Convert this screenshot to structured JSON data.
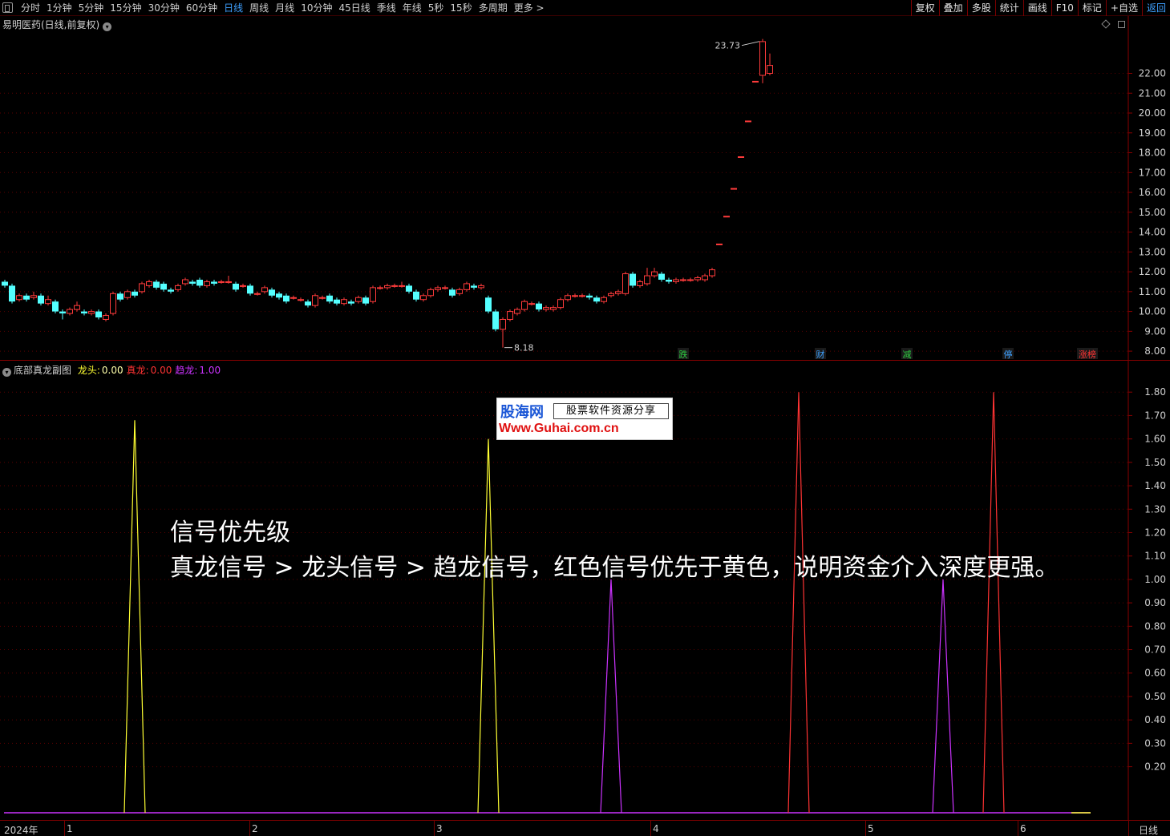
{
  "toolbar": {
    "periods": [
      "分时",
      "1分钟",
      "5分钟",
      "15分钟",
      "30分钟",
      "60分钟",
      "日线",
      "周线",
      "月线",
      "10分钟",
      "45日线",
      "季线",
      "年线",
      "5秒",
      "15秒",
      "多周期",
      "更多 >"
    ],
    "active_period": "日线",
    "tools": [
      "复权",
      "叠加",
      "多股",
      "统计",
      "画线",
      "F10",
      "标记",
      "+自选",
      "返回"
    ]
  },
  "price_panel": {
    "title": "易明医药(日线,前复权)",
    "y_ticks": [
      "22.00",
      "21.00",
      "20.00",
      "19.00",
      "18.00",
      "17.00",
      "16.00",
      "15.00",
      "14.00",
      "13.00",
      "12.00",
      "11.00",
      "10.00",
      "9.00",
      "8.00"
    ],
    "high_label": "23.73",
    "low_label": "8.18",
    "event_tags": [
      {
        "text": "跌",
        "color": "#2ecc40"
      },
      {
        "text": "财",
        "color": "#3ea0ff"
      },
      {
        "text": "减",
        "color": "#2ecc40"
      },
      {
        "text": "停",
        "color": "#3ea0ff"
      },
      {
        "text": "涨榜",
        "color": "#ff3333"
      }
    ]
  },
  "indicator_panel": {
    "name": "底部真龙副图",
    "series": [
      {
        "label": "龙头",
        "value": "0.00",
        "color": "#ffff33"
      },
      {
        "label": "真龙",
        "value": "0.00",
        "color": "#ff3333"
      },
      {
        "label": "趋龙",
        "value": "1.00",
        "color": "#cc33ff"
      }
    ],
    "y_ticks": [
      "1.80",
      "1.70",
      "1.60",
      "1.50",
      "1.40",
      "1.30",
      "1.20",
      "1.10",
      "1.00",
      "0.90",
      "0.80",
      "0.70",
      "0.60",
      "0.50",
      "0.40",
      "0.30",
      "0.20"
    ]
  },
  "watermark": {
    "logo": "股海网",
    "slogan": "股票软件资源分享",
    "url": "Www.Guhai.com.cn"
  },
  "caption": {
    "line1": "信号优先级",
    "line2": "真龙信号 > 龙头信号 > 趋龙信号，红色信号优先于黄色，说明资金介入深度更强。"
  },
  "date_bar": {
    "labels": [
      "2024年",
      "1",
      "2",
      "3",
      "4",
      "5",
      "6"
    ],
    "period": "日线"
  },
  "chart_data": [
    {
      "type": "candlestick",
      "title": "易明医药(日线,前复权)",
      "ylim": [
        7.6,
        24.0
      ],
      "x_month_labels": [
        "2024年",
        "1",
        "2",
        "3",
        "4",
        "5",
        "6"
      ],
      "candles": [
        [
          11.5,
          11.3,
          11.6,
          11.2
        ],
        [
          11.3,
          10.5,
          11.4,
          10.4
        ],
        [
          10.6,
          10.8,
          10.9,
          10.5
        ],
        [
          10.8,
          10.6,
          10.9,
          10.5
        ],
        [
          10.7,
          10.8,
          11.0,
          10.6
        ],
        [
          10.8,
          10.4,
          10.9,
          10.3
        ],
        [
          10.4,
          10.6,
          10.8,
          10.3
        ],
        [
          10.5,
          10.0,
          10.6,
          9.9
        ],
        [
          10.0,
          9.9,
          10.1,
          9.6
        ],
        [
          9.9,
          10.1,
          10.2,
          9.8
        ],
        [
          10.1,
          10.3,
          10.5,
          10.0
        ],
        [
          10.0,
          9.9,
          10.1,
          9.8
        ],
        [
          9.9,
          10.0,
          10.1,
          9.8
        ],
        [
          10.0,
          9.7,
          10.1,
          9.6
        ],
        [
          9.6,
          9.8,
          9.9,
          9.5
        ],
        [
          9.9,
          10.9,
          11.0,
          9.8
        ],
        [
          10.9,
          10.6,
          11.0,
          10.5
        ],
        [
          10.7,
          11.0,
          11.1,
          10.6
        ],
        [
          11.0,
          10.8,
          11.1,
          10.7
        ],
        [
          11.0,
          11.4,
          11.5,
          10.9
        ],
        [
          11.3,
          11.5,
          11.6,
          11.2
        ],
        [
          11.5,
          11.2,
          11.6,
          11.1
        ],
        [
          11.4,
          11.1,
          11.5,
          11.0
        ],
        [
          11.1,
          11.0,
          11.2,
          10.9
        ],
        [
          11.1,
          11.3,
          11.4,
          11.0
        ],
        [
          11.4,
          11.6,
          11.7,
          11.3
        ],
        [
          11.5,
          11.4,
          11.6,
          11.3
        ],
        [
          11.6,
          11.3,
          11.7,
          11.2
        ],
        [
          11.3,
          11.5,
          11.6,
          11.2
        ],
        [
          11.5,
          11.4,
          11.6,
          11.3
        ],
        [
          11.5,
          11.5,
          11.6,
          11.4
        ],
        [
          11.5,
          11.5,
          11.8,
          11.4
        ],
        [
          11.4,
          11.1,
          11.5,
          11.0
        ],
        [
          11.3,
          11.3,
          11.4,
          11.2
        ],
        [
          11.3,
          10.9,
          11.4,
          10.8
        ],
        [
          10.9,
          10.9,
          11.0,
          10.8
        ],
        [
          11.0,
          11.2,
          11.3,
          10.9
        ],
        [
          11.1,
          10.8,
          11.2,
          10.7
        ],
        [
          10.9,
          10.7,
          11.0,
          10.6
        ],
        [
          10.8,
          10.5,
          10.9,
          10.4
        ],
        [
          10.7,
          10.7,
          10.8,
          10.6
        ],
        [
          10.6,
          10.6,
          10.7,
          10.5
        ],
        [
          10.5,
          10.3,
          10.6,
          10.2
        ],
        [
          10.3,
          10.8,
          10.9,
          10.2
        ],
        [
          10.7,
          10.7,
          10.8,
          10.6
        ],
        [
          10.8,
          10.5,
          10.9,
          10.4
        ],
        [
          10.6,
          10.4,
          10.7,
          10.3
        ],
        [
          10.4,
          10.6,
          10.7,
          10.3
        ],
        [
          10.5,
          10.4,
          10.6,
          10.3
        ],
        [
          10.5,
          10.7,
          10.8,
          10.4
        ],
        [
          10.7,
          10.4,
          10.8,
          10.3
        ],
        [
          10.5,
          11.2,
          11.3,
          10.4
        ],
        [
          11.2,
          11.2,
          11.3,
          11.1
        ],
        [
          11.2,
          11.3,
          11.4,
          11.1
        ],
        [
          11.3,
          11.3,
          11.4,
          11.2
        ],
        [
          11.3,
          11.3,
          11.5,
          11.2
        ],
        [
          11.3,
          11.0,
          11.4,
          10.9
        ],
        [
          11.0,
          10.6,
          11.1,
          10.5
        ],
        [
          10.6,
          10.8,
          10.9,
          10.5
        ],
        [
          10.8,
          11.1,
          11.2,
          10.7
        ],
        [
          11.1,
          11.2,
          11.3,
          11.0
        ],
        [
          11.2,
          11.2,
          11.3,
          11.1
        ],
        [
          11.1,
          10.8,
          11.2,
          10.7
        ],
        [
          10.9,
          11.1,
          11.2,
          10.8
        ],
        [
          11.1,
          11.4,
          11.5,
          11.0
        ],
        [
          11.3,
          11.2,
          11.4,
          11.1
        ],
        [
          11.2,
          11.3,
          11.4,
          11.1
        ],
        [
          10.7,
          10.0,
          10.8,
          9.9
        ],
        [
          10.0,
          9.1,
          10.1,
          9.0
        ],
        [
          9.1,
          9.6,
          9.7,
          8.18
        ],
        [
          9.6,
          10.0,
          10.1,
          9.5
        ],
        [
          9.9,
          10.1,
          10.2,
          9.8
        ],
        [
          10.1,
          10.5,
          10.6,
          10.0
        ],
        [
          10.4,
          10.4,
          10.5,
          10.3
        ],
        [
          10.4,
          10.1,
          10.5,
          10.0
        ],
        [
          10.1,
          10.2,
          10.3,
          10.0
        ],
        [
          10.1,
          10.2,
          10.3,
          10.0
        ],
        [
          10.2,
          10.6,
          10.7,
          10.1
        ],
        [
          10.6,
          10.8,
          10.9,
          10.5
        ],
        [
          10.8,
          10.8,
          10.9,
          10.7
        ],
        [
          10.8,
          10.8,
          10.9,
          10.7
        ],
        [
          10.8,
          10.7,
          10.9,
          10.6
        ],
        [
          10.7,
          10.5,
          10.8,
          10.4
        ],
        [
          10.5,
          10.7,
          10.8,
          10.4
        ],
        [
          10.8,
          10.9,
          11.0,
          10.7
        ],
        [
          10.9,
          11.0,
          11.1,
          10.8
        ],
        [
          10.9,
          11.9,
          12.0,
          10.8
        ],
        [
          11.9,
          11.3,
          12.0,
          11.2
        ],
        [
          11.3,
          11.5,
          11.6,
          11.2
        ],
        [
          11.4,
          11.8,
          12.2,
          11.3
        ],
        [
          11.8,
          12.0,
          12.2,
          11.7
        ],
        [
          11.9,
          11.6,
          12.0,
          11.5
        ],
        [
          11.6,
          11.5,
          11.7,
          11.4
        ],
        [
          11.5,
          11.6,
          11.7,
          11.4
        ],
        [
          11.6,
          11.6,
          11.7,
          11.5
        ],
        [
          11.6,
          11.6,
          11.7,
          11.5
        ],
        [
          11.6,
          11.7,
          11.8,
          11.5
        ],
        [
          11.6,
          11.8,
          11.9,
          11.5
        ],
        [
          11.8,
          12.1,
          12.2,
          11.7
        ],
        [
          13.4,
          13.4,
          13.4,
          13.4
        ],
        [
          14.8,
          14.8,
          14.8,
          14.8
        ],
        [
          16.2,
          16.2,
          16.2,
          16.2
        ],
        [
          17.8,
          17.8,
          17.8,
          17.8
        ],
        [
          19.6,
          19.6,
          19.6,
          19.6
        ],
        [
          21.6,
          21.6,
          21.6,
          21.6
        ],
        [
          21.9,
          23.6,
          23.73,
          21.5
        ],
        [
          22.0,
          22.4,
          23.0,
          21.9
        ]
      ]
    },
    {
      "type": "line",
      "title": "底部真龙副图",
      "ylim": [
        0,
        1.9
      ],
      "series": [
        {
          "name": "龙头",
          "color": "#ffff33",
          "spikes": [
            {
              "t": 18,
              "v": 1.68
            },
            {
              "t": 67,
              "v": 1.6
            }
          ]
        },
        {
          "name": "真龙",
          "color": "#ff3333",
          "spikes": [
            {
              "t": 110,
              "v": 1.8
            },
            {
              "t": 137,
              "v": 1.8
            }
          ]
        },
        {
          "name": "趋龙",
          "color": "#cc33ff",
          "spikes": [
            {
              "t": 84,
              "v": 1.0
            },
            {
              "t": 130,
              "v": 1.0
            }
          ]
        }
      ]
    }
  ]
}
